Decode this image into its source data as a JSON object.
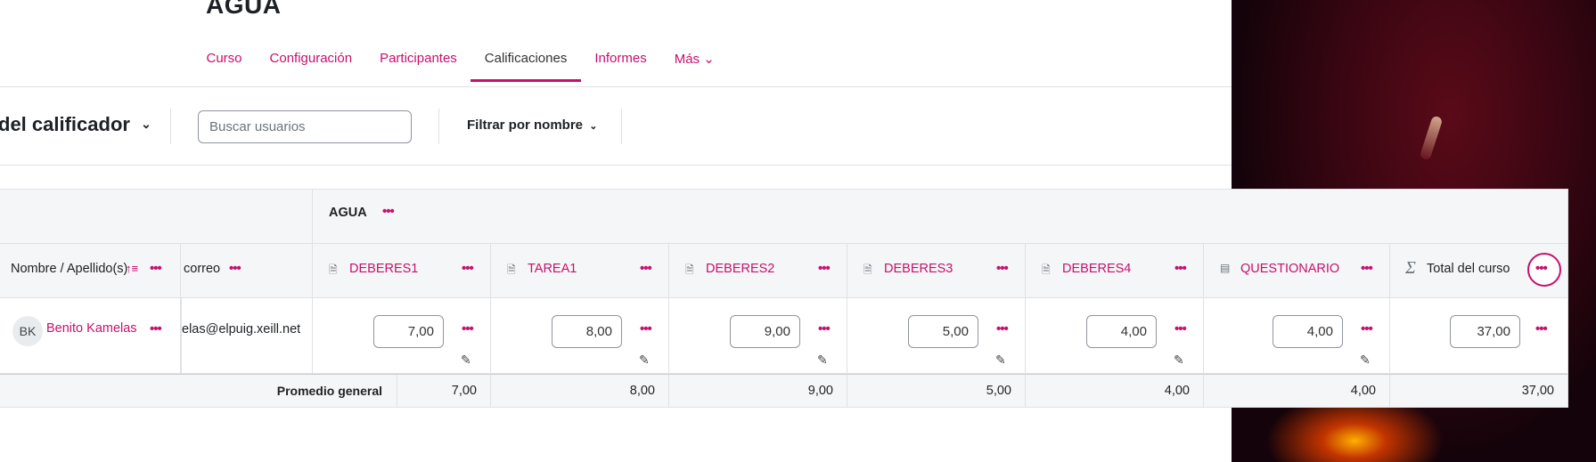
{
  "course": {
    "title": "AGUA"
  },
  "nav": {
    "tabs": [
      {
        "label": "Curso"
      },
      {
        "label": "Configuración"
      },
      {
        "label": "Participantes"
      },
      {
        "label": "Calificaciones"
      },
      {
        "label": "Informes"
      },
      {
        "label": "Más ⌄"
      }
    ],
    "active_tab": "Calificaciones"
  },
  "toolbar": {
    "view_label": "del calificador",
    "search_placeholder": "Buscar usuarios",
    "filter_label": "Filtrar por nombre"
  },
  "grid": {
    "category": "AGUA",
    "name_header": "Nombre / Apellido(s)",
    "email_header": "correo",
    "items": [
      {
        "label": "DEBERES1",
        "icon": "assignment-icon",
        "grade": "7,00",
        "average": "7,00"
      },
      {
        "label": "TAREA1",
        "icon": "assignment-icon",
        "grade": "8,00",
        "average": "8,00"
      },
      {
        "label": "DEBERES2",
        "icon": "assignment-icon",
        "grade": "9,00",
        "average": "9,00"
      },
      {
        "label": "DEBERES3",
        "icon": "assignment-icon",
        "grade": "5,00",
        "average": "5,00"
      },
      {
        "label": "DEBERES4",
        "icon": "assignment-icon",
        "grade": "4,00",
        "average": "4,00"
      },
      {
        "label": "QUESTIONARIO",
        "icon": "quiz-icon",
        "grade": "4,00",
        "average": "4,00"
      }
    ],
    "total": {
      "label": "Total del curso",
      "icon": "sigma-icon",
      "grade": "37,00",
      "average": "37,00"
    },
    "student": {
      "initials": "BK",
      "name": "Benito Kamelas",
      "email": "elas@elpuig.xeill.net"
    },
    "average_label": "Promedio general"
  },
  "colors": {
    "accent": "#c6106d",
    "border": "#dee2e6",
    "header_bg": "#f5f6f7"
  }
}
